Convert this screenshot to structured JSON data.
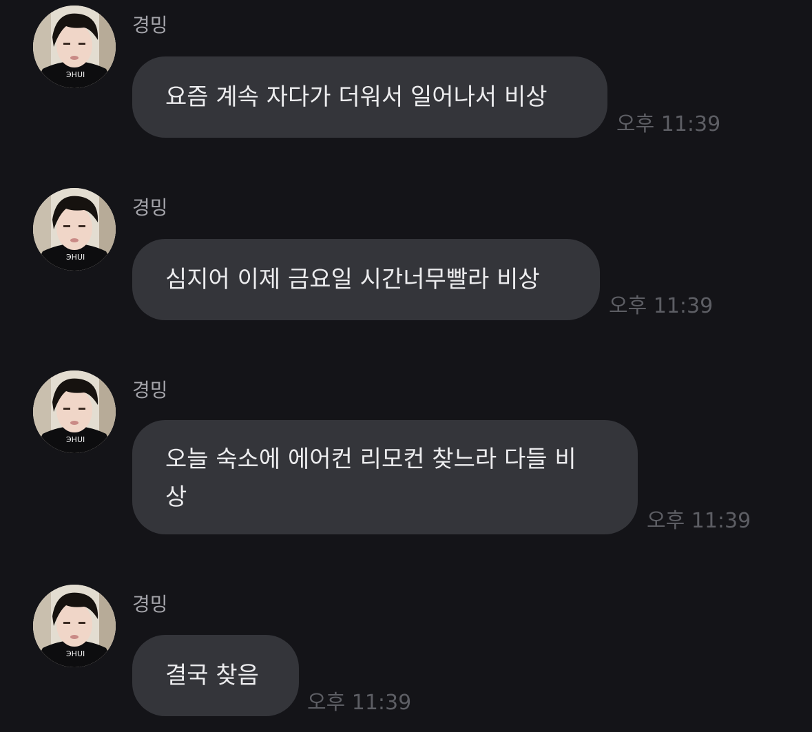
{
  "messages": [
    {
      "sender": "경밍",
      "text": "요즘 계속 자다가 더워서 일어나서 비상",
      "time": "오후 11:39"
    },
    {
      "sender": "경밍",
      "text": "심지어 이제 금요일 시간너무빨라 비상",
      "time": "오후 11:39"
    },
    {
      "sender": "경밍",
      "text": "오늘 숙소에 에어컨 리모컨 찾느라 다들 비\n상",
      "time": "오후 11:39"
    },
    {
      "sender": "경밍",
      "text": "결국 찾음",
      "time": "오후 11:39"
    }
  ],
  "colors": {
    "background": "#141418",
    "bubble": "#34353a",
    "bubble_text": "#ececee",
    "sender_text": "#a4a4aa",
    "time_text": "#5d5e64"
  },
  "icons": {
    "avatar": "profile-photo-avatar"
  }
}
